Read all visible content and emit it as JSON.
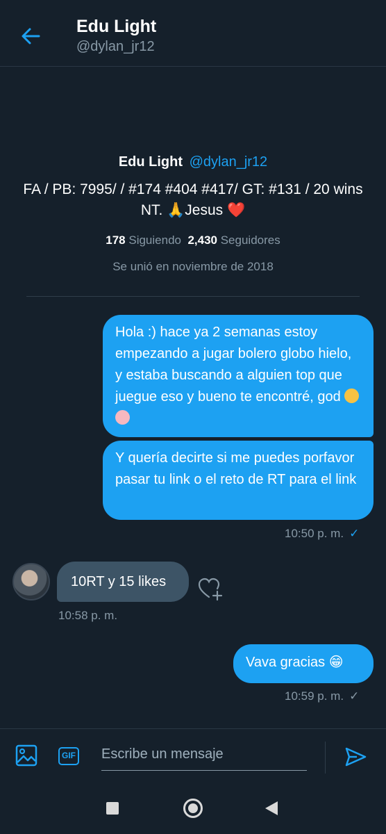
{
  "header": {
    "name": "Edu Light",
    "handle": "@dylan_jr12"
  },
  "profile": {
    "name": "Edu Light",
    "handle": "@dylan_jr12",
    "bio": "FA / PB: 7995/ / #174 #404 #417/ GT: #131 / 20 wins NT. 🙏Jesus ❤️",
    "following_count": "178",
    "following_label": "Siguiendo",
    "followers_count": "2,430",
    "followers_label": "Seguidores",
    "joined": "Se unió en noviembre de 2018"
  },
  "messages": [
    {
      "direction": "out",
      "text": "Hola :) hace ya 2 semanas estoy empezando a jugar bolero globo hielo, y estaba buscando a alguien top que juegue eso y bueno te encontré, god"
    },
    {
      "direction": "out",
      "text": "Y quería decirte si me puedes porfavor pasar tu link o el reto de RT para el link",
      "time": "10:50 p. m.",
      "status": "read"
    },
    {
      "direction": "in",
      "text": "10RT y 15 likes",
      "time": "10:58 p. m."
    },
    {
      "direction": "out",
      "text": "Vava gracias 😁",
      "time": "10:59 p. m.",
      "status": "sent"
    }
  ],
  "composer": {
    "placeholder": "Escribe un mensaje",
    "gif_label": "GIF"
  },
  "colors": {
    "background": "#15202b",
    "accent": "#1da1f2",
    "incoming_bubble": "#3d5466",
    "muted_text": "#8899a6"
  },
  "icons": [
    "back-arrow-icon",
    "heart-plus-icon",
    "image-icon",
    "gif-icon",
    "send-icon",
    "nav-recents-icon",
    "nav-home-icon",
    "nav-back-icon"
  ]
}
